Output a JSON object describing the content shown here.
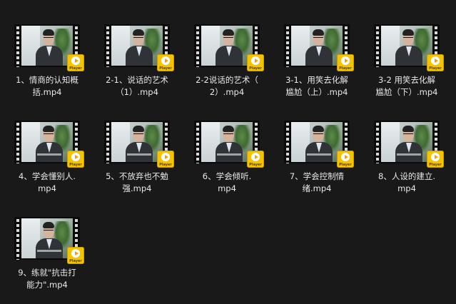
{
  "badge_label": "Player",
  "colors": {
    "background": "#191919",
    "badge": "#f5c400",
    "text": "#e8e8e8"
  },
  "files": [
    {
      "name": "1、情商的认知概\n括.mp4",
      "icon": "video-file-icon"
    },
    {
      "name": "2-1、说话的艺术\n（1）.mp4",
      "icon": "video-file-icon"
    },
    {
      "name": "2-2说话的艺术（\n2）.mp4",
      "icon": "video-file-icon"
    },
    {
      "name": "3-1、用笑去化解\n尴尬（上）.mp4",
      "icon": "video-file-icon"
    },
    {
      "name": "3-2 用笑去化解\n尴尬（下）.mp4",
      "icon": "video-file-icon"
    },
    {
      "name": "4、学会懂别人.\nmp4",
      "icon": "video-file-icon"
    },
    {
      "name": "5、不放弃也不勉\n强.mp4",
      "icon": "video-file-icon"
    },
    {
      "name": "6、学会倾听.\nmp4",
      "icon": "video-file-icon"
    },
    {
      "name": "7、学会控制情\n绪.mp4",
      "icon": "video-file-icon"
    },
    {
      "name": "8、人设的建立.\nmp4",
      "icon": "video-file-icon"
    },
    {
      "name": "9、练就\"抗击打\n能力\".mp4",
      "icon": "video-file-icon"
    }
  ]
}
